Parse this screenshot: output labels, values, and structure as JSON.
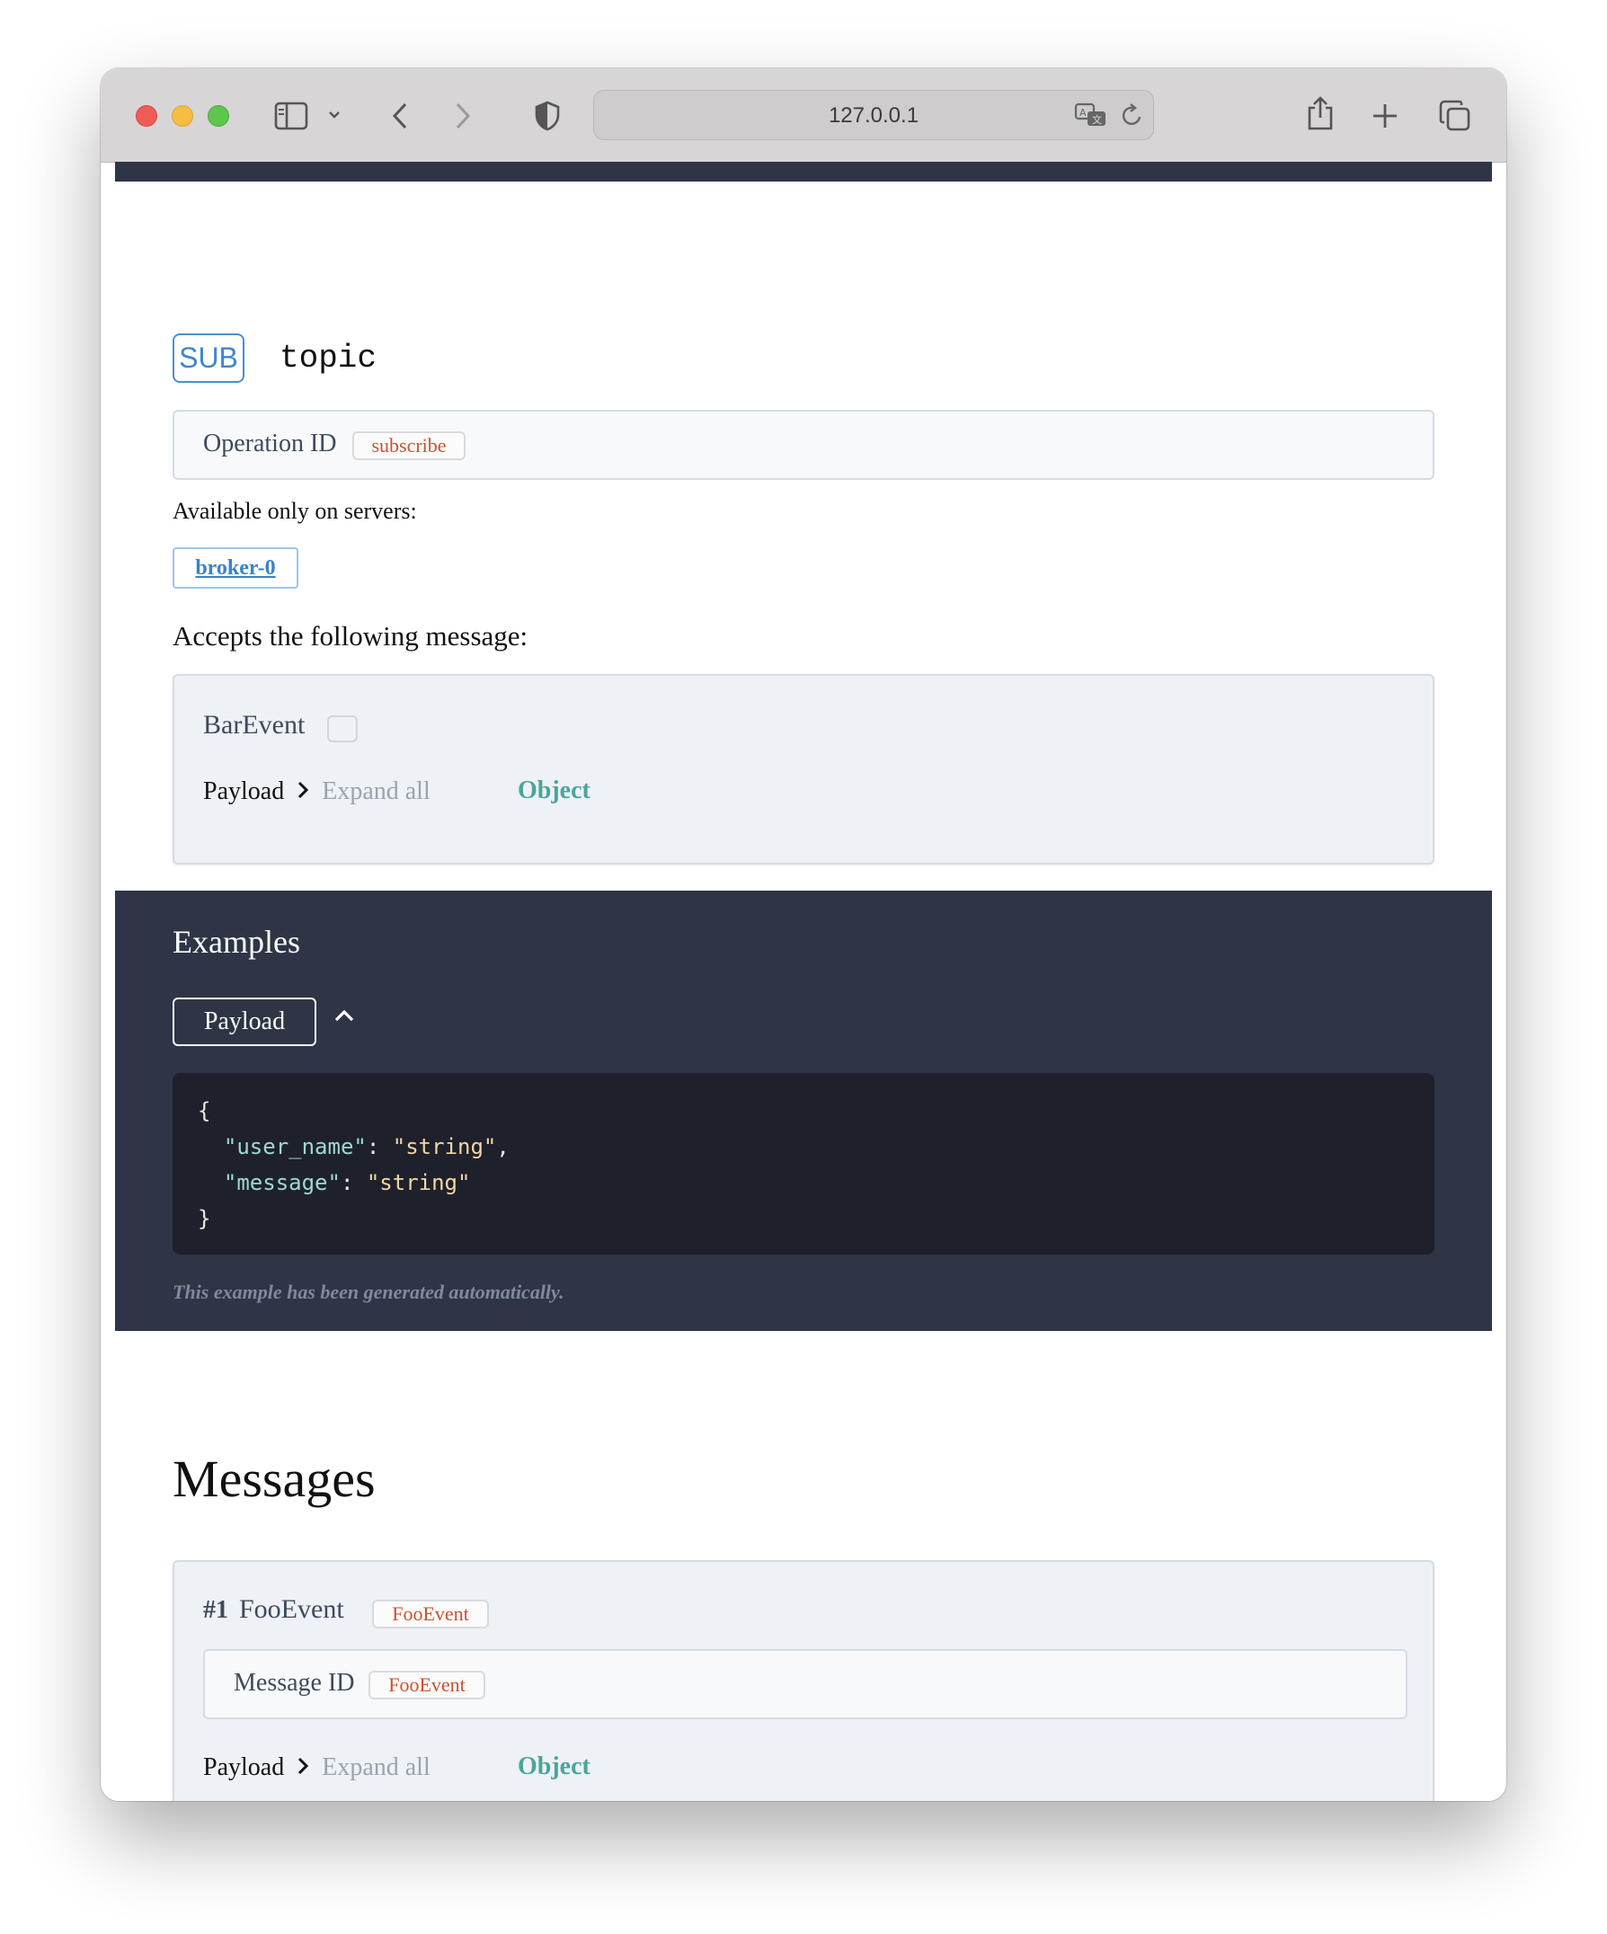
{
  "browser": {
    "address": "127.0.0.1"
  },
  "operation": {
    "badge": "SUB",
    "channel": "topic",
    "operation_id_label": "Operation ID",
    "operation_id": "subscribe",
    "servers_label": "Available only on servers:",
    "servers": [
      "broker-0"
    ],
    "accepts_label": "Accepts the following message:",
    "message": {
      "name": "BarEvent",
      "payload_label": "Payload",
      "expand_all": "Expand all",
      "type": "Object"
    }
  },
  "examples": {
    "title": "Examples",
    "payload_button": "Payload",
    "code": {
      "open": "{",
      "key1": "\"user_name\"",
      "val1": "\"string\"",
      "key2": "\"message\"",
      "val2": "\"string\"",
      "close": "}"
    },
    "note": "This example has been generated automatically."
  },
  "messages": {
    "title": "Messages",
    "items": [
      {
        "number": "#1",
        "name": "FooEvent",
        "tag": "FooEvent",
        "message_id_label": "Message ID",
        "message_id": "FooEvent",
        "payload_label": "Payload",
        "expand_all": "Expand all",
        "type": "Object"
      }
    ]
  }
}
